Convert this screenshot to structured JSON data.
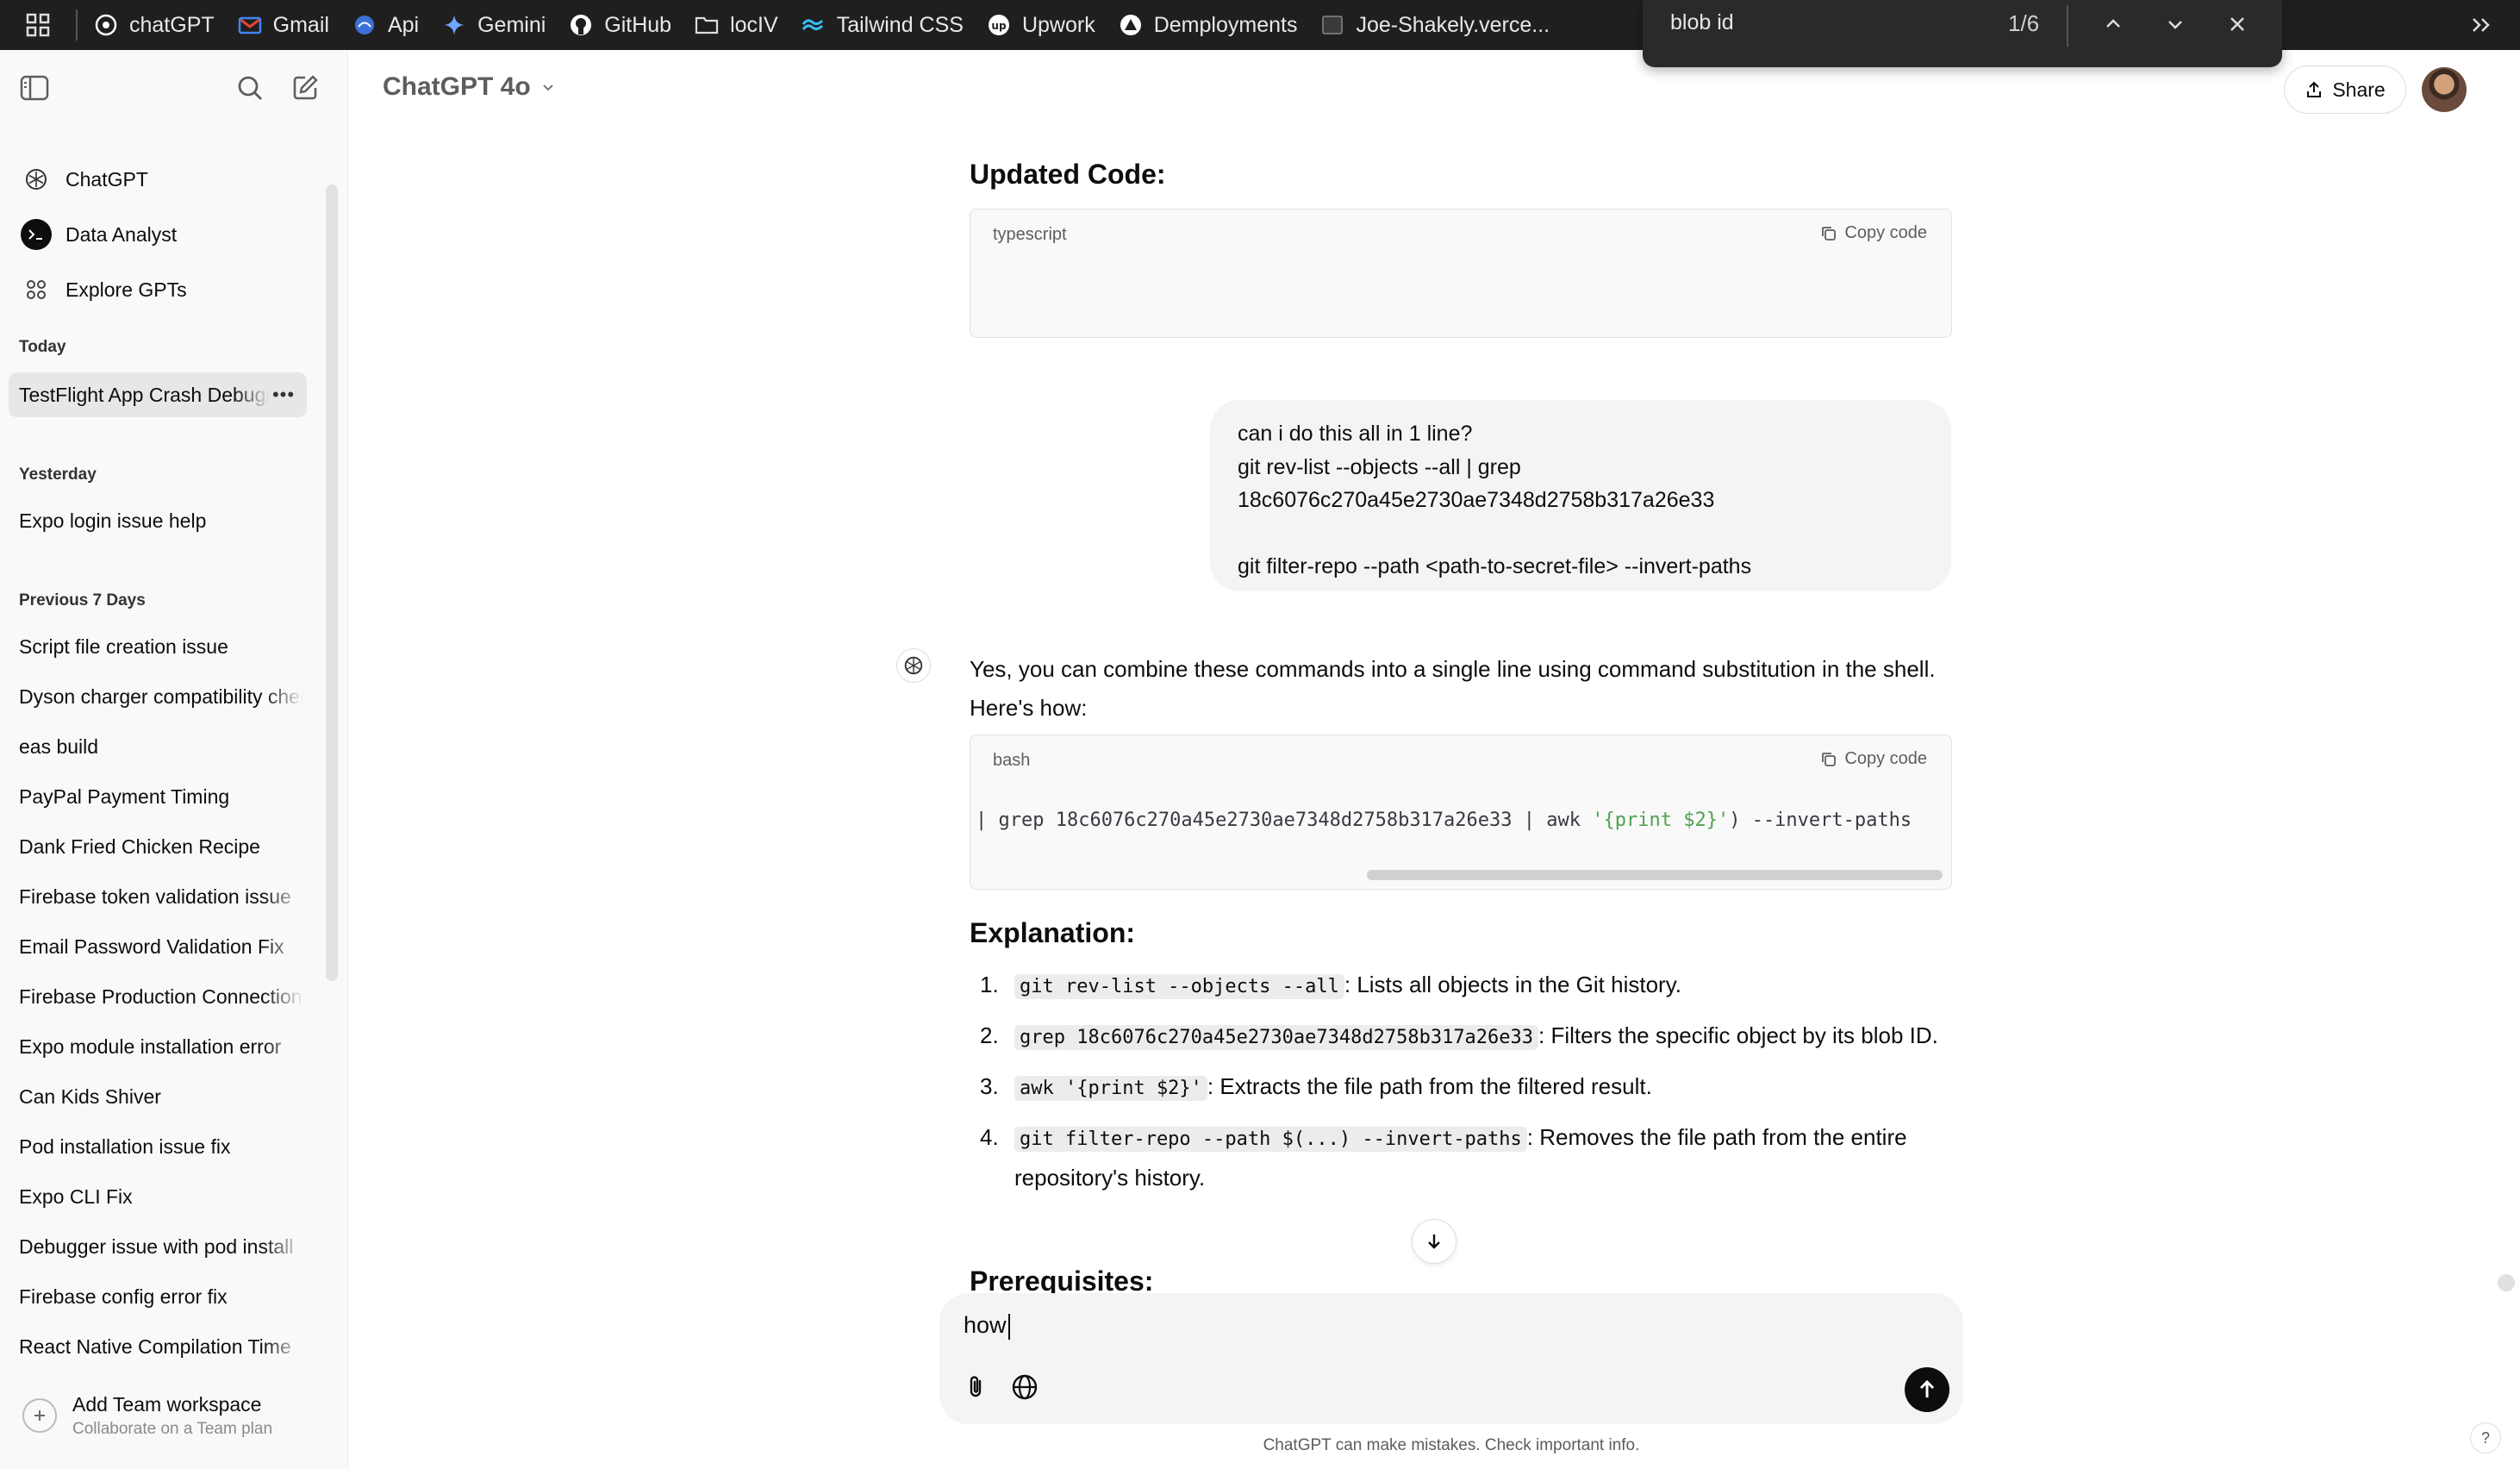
{
  "bookmarks": {
    "items": [
      {
        "label": "chatGPT",
        "icon": "openai-icon"
      },
      {
        "label": "Gmail",
        "icon": "gmail-icon"
      },
      {
        "label": "Api",
        "icon": "globe-icon"
      },
      {
        "label": "Gemini",
        "icon": "gemini-icon"
      },
      {
        "label": "GitHub",
        "icon": "github-icon"
      },
      {
        "label": "locIV",
        "icon": "folder-icon"
      },
      {
        "label": "Tailwind CSS",
        "icon": "tailwind-icon"
      },
      {
        "label": "Upwork",
        "icon": "upwork-icon"
      },
      {
        "label": "Demployments",
        "icon": "vercel-icon"
      },
      {
        "label": "Joe-Shakely.verce...",
        "icon": "site-icon"
      }
    ]
  },
  "findbar": {
    "query": "blob id",
    "count": "1/6"
  },
  "sidebar": {
    "gpts": [
      {
        "label": "ChatGPT",
        "icon": "openai-icon"
      },
      {
        "label": "Data Analyst",
        "icon": "terminal-icon"
      },
      {
        "label": "Explore GPTs",
        "icon": "grid-icon"
      }
    ],
    "today_label": "Today",
    "today": [
      "TestFlight App Crash Debugging"
    ],
    "yesterday_label": "Yesterday",
    "yesterday": [
      "Expo login issue help"
    ],
    "prev7_label": "Previous 7 Days",
    "prev7": [
      "Script file creation issue",
      "Dyson charger compatibility check",
      "eas build",
      "PayPal Payment Timing",
      "Dank Fried Chicken Recipe",
      "Firebase token validation issue",
      "Email Password Validation Fix",
      "Firebase Production Connection",
      "Expo module installation error",
      "Can Kids Shiver",
      "Pod installation issue fix",
      "Expo CLI Fix",
      "Debugger issue with pod install",
      "Firebase config error fix",
      "React Native Compilation Time"
    ],
    "team": {
      "title": "Add Team workspace",
      "subtitle": "Collaborate on a Team plan"
    }
  },
  "header": {
    "model": "ChatGPT 4o",
    "share": "Share"
  },
  "chat": {
    "updated_heading": "Updated Code:",
    "code1": {
      "lang": "typescript",
      "copy": "Copy code"
    },
    "user_message": [
      "can i do this all in 1 line?",
      "git rev-list --objects --all | grep",
      "18c6076c270a45e2730ae7348d2758b317a26e33",
      "",
      "git filter-repo --path <path-to-secret-file> --invert-paths"
    ],
    "assistant_intro": "Yes, you can combine these commands into a single line using command substitution in the shell. Here's how:",
    "code2": {
      "lang": "bash",
      "copy": "Copy code",
      "line_pre": "| grep 18c6076c270a45e2730ae7348d2758b317a26e33 | awk ",
      "line_str": "'{print $2}'",
      "line_post": ") --invert-paths"
    },
    "explanation_heading": "Explanation:",
    "explanation": [
      {
        "num": "1.",
        "code": "git rev-list --objects --all",
        "text": ": Lists all objects in the Git history."
      },
      {
        "num": "2.",
        "code": "grep 18c6076c270a45e2730ae7348d2758b317a26e33",
        "text": ": Filters the specific object by its blob ID."
      },
      {
        "num": "3.",
        "code": "awk '{print $2}'",
        "text": ": Extracts the file path from the filtered result."
      },
      {
        "num": "4.",
        "code": "git filter-repo --path $(...) --invert-paths",
        "text": ": Removes the file path from the entire repository's history."
      }
    ],
    "prereq_heading": "Prerequisites:"
  },
  "composer": {
    "value": "how",
    "disclaimer": "ChatGPT can make mistakes. Check important info."
  },
  "help": "?"
}
